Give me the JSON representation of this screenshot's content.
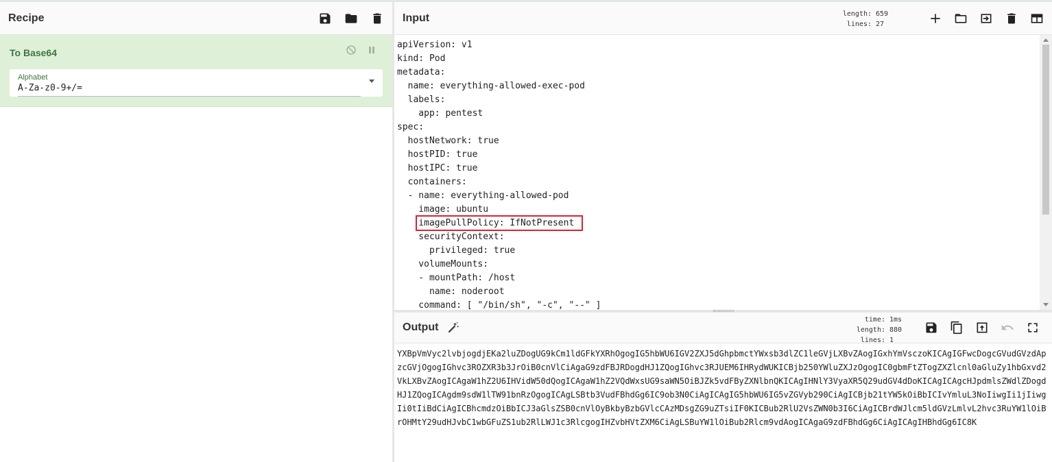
{
  "recipe": {
    "title": "Recipe",
    "operation": {
      "name": "To Base64",
      "alphabet_label": "Alphabet",
      "alphabet_value": "A-Za-z0-9+/="
    }
  },
  "input": {
    "title": "Input",
    "length_label": "length:",
    "length_value": "659",
    "lines_label": "lines:",
    "lines_value": "27",
    "text": "apiVersion: v1\nkind: Pod\nmetadata:\n  name: everything-allowed-exec-pod\n  labels:\n    app: pentest\nspec:\n  hostNetwork: true\n  hostPID: true\n  hostIPC: true\n  containers:\n  - name: everything-allowed-pod\n    image: ubuntu\n    imagePullPolicy: IfNotPresent\n    securityContext:\n      privileged: true\n    volumeMounts:\n    - mountPath: /host\n      name: noderoot\n    command: [ \"/bin/sh\", \"-c\", \"--\" ]"
  },
  "output": {
    "title": "Output",
    "time_label": "time:",
    "time_value": "1ms",
    "length_label": "length:",
    "length_value": "880",
    "lines_label": "lines:",
    "lines_value": "1",
    "text": "YXBpVmVyc2lvbjogdjEKa2luZDogUG9kCm1ldGFkYXRhOgogIG5hbWU6IGV2ZXJ5dGhpbmctYWxsb3dlZC1leGVjLXBvZAogIGxhYmVsczoKICAgIGFwcDogcGVudGVzdApzcGVjOgogIGhvc3ROZXR3b3JrOiB0cnVlCiAgaG9zdFBJRDogdHJ1ZQogIGhvc3RJUEM6IHRydWUKICBjb250YWluZXJzOgogIC0gbmFtZTogZXZlcnl0aGluZy1hbGxvd2VkLXBvZAogICAgaW1hZ2U6IHVidW50dQogICAgaW1hZ2VQdWxsUG9saWN5OiBJZk5vdFByZXNlbnQKICAgIHNlY3VyaXR5Q29udGV4dDoKICAgICAgcHJpdmlsZWdlZDogdHJ1ZQogICAgdm9sdW1lTW91bnRzOgogICAgLSBtb3VudFBhdGg6IC9ob3N0CiAgICAgIG5hbWU6IG5vZGVyb290CiAgICBjb21tYW5kOiBbICIvYmluL3NoIiwgIi1jIiwgIi0tIiBdCiAgICBhcmdzOiBbICJ3aGlsZSB0cnVlOyBkbyBzbGVlcCAzMDsgZG9uZTsiIF0KICBub2RlU2VsZWN0b3I6CiAgICBrdWJlcm5ldGVzLmlvL2hvc3RuYW1lOiBrOHMtY29udHJvbC1wbGFuZS1ub2RlLWJ1c3RlcgogIHZvbHVtZXM6CiAgLSBuYW1lOiBub2Rlcm9vdAogICAgaG9zdFBhdGg6CiAgICAgIHBhdGg6IC8K",
    "visible_text": "YXBpVmVyc2lvbjogdjEKa2luZDogUG9kCm1ldGFkYXRhOgogIG5hbWU6IGV2ZXJ5dGhpbmctYWxsb3dlZC1leGVjLXBvZAogIGxhYmVsczoKICAgIGFwcDogcGVudGVzdApzcGVjOgogIGhvc3ROZXR3b3JrOiB0cnVlCiAgaG9zdFBJRDogdHJ1ZQogIGhvc3RJUEM6IHRydWUKICBjb250YWluZXJzOgogIC0gbmFtZTogZXZlcnl0aGluZy1hbGxvd2VkLXBvZAogICAgaW1hZ2U6IHVidW50dQogICAgaW1hZ2VQdWxsUG9saWN5OiBJZk5vdFByZXNlbnQKICAgIHNlY3VyaXR5Q29udGV4dDoKICAgICAgcHJpdmlsZWdlZDogdHJ1ZQogICAgdm9sdW1lTW91bnRzOgogICAgLSBtb3VudFBhdGg6IC9ob3N0CiAgICAgIG5hbWU6IG5vZGVyb290CiAgICBjb21tYW5kOiBbICIvYmluL3NoIiwgIi1jIiwgIi0tIiBdCiAgICBhcmdzOiBbICJ3aGlsZSB0cnVlOyBkbyBzbGVlcCAzMDsgZG9uZTsiIF0KICBub2RlU2VsZWN0b3I6CiAgICBrdWJlcm5ldGVzLmlvL2hvc3RuYW1lOiBrOHMtY29udHJvbC1wbGFuZS1ub2RlLWJ1c3RlcgogIHZvbHVtZXM6CiAgLSBuYW1lOiBub2Rlcm9vdAogICAgaG9zdFBhdGg6CiAgICAgIHBhdGg6IC8K"
  },
  "colors": {
    "operation_bg": "#dff0d8",
    "operation_text": "#3c763d",
    "highlight_box": "#d9232e"
  }
}
